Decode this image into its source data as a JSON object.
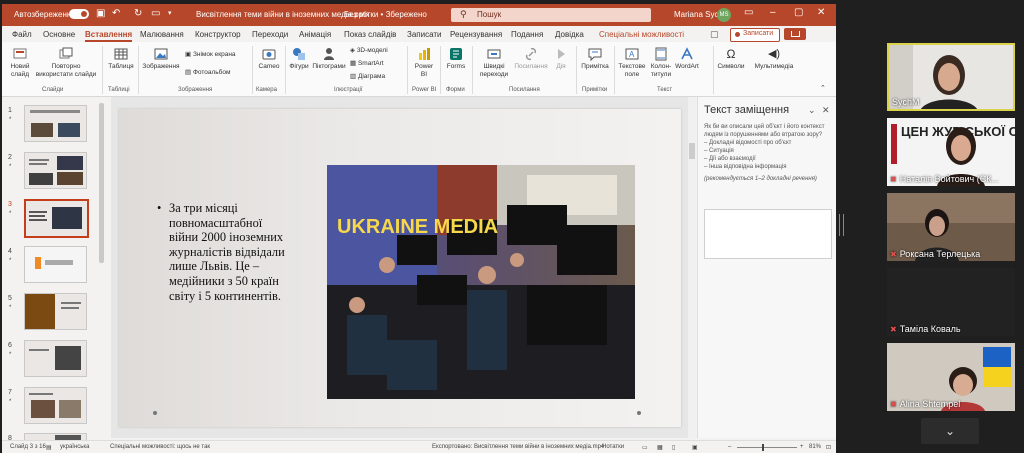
{
  "title_bar": {
    "autosave_label": "Автозбереження",
    "doc_title": "Висвітлення теми війни в іноземних медіа.pptx",
    "sensitivity": "Без мітки • Збережено",
    "search_placeholder": "Пошук",
    "user_name": "Mariana Sych",
    "user_initials": "MS"
  },
  "tabs": [
    "Файл",
    "Основне",
    "Вставлення",
    "Малювання",
    "Конструктор",
    "Переходи",
    "Анімація",
    "Показ слайдів",
    "Записати",
    "Рецензування",
    "Подання",
    "Довідка",
    "Спеціальні можливості"
  ],
  "active_tab": "Вставлення",
  "record_button": "Записати",
  "ribbon": {
    "new_slide": "Новий слайд",
    "reuse_slides": "Повторно використати слайди",
    "table": "Таблиця",
    "images": "Зображення",
    "screenshot": "Знімок екрана",
    "photo_album": "Фотоальбом",
    "cameo": "Cameo",
    "shapes": "Фігури",
    "pictograms": "Піктограми",
    "models3d": "3D-моделі",
    "smartart": "SmartArt",
    "diagram": "Діаграма",
    "powerbi": "Power BI",
    "forms": "Forms",
    "quick_links": "Швидкі переходи",
    "link": "Посилання",
    "action": "Дія",
    "comment": "Примітка",
    "textbox": "Текстове поле",
    "header_footer": "Колон-титули",
    "wordart": "WordArt",
    "symbols": "Символи",
    "multimedia": "Мультимедіа",
    "groups": {
      "slides": "Слайди",
      "tables": "Таблиці",
      "images": "Зображення",
      "camera": "Камера",
      "illustrations": "Ілюстрації",
      "powerbi": "Power BI",
      "forms": "Форми",
      "links": "Посилання",
      "comments": "Примітки",
      "text": "Текст"
    }
  },
  "thumbnails": [
    {
      "num": "1",
      "star": "*"
    },
    {
      "num": "2",
      "star": "*"
    },
    {
      "num": "3",
      "star": "*"
    },
    {
      "num": "4",
      "star": "*"
    },
    {
      "num": "5",
      "star": "*"
    },
    {
      "num": "6",
      "star": "*"
    },
    {
      "num": "7",
      "star": "*"
    },
    {
      "num": "8",
      "star": ""
    }
  ],
  "slide": {
    "bullet_text": "За три місяці повномасштабної війни 2000 іноземних журналістів відвідали лише Львів. Це – медійники з 50 країн світу і 5 континентів."
  },
  "alt_text": {
    "title": "Текст заміщення",
    "description": "Як би ви описали цей об'єкт і його контекст людям із порушеннями або втратою зору?",
    "items": [
      "– Докладні відомості про об'єкт",
      "– Ситуація",
      "– Дії або взаємодії",
      "– Інша відповідна інформація"
    ],
    "hint": "(рекомендується 1–2 докладні речення)"
  },
  "status_bar": {
    "slide_counter": "Слайд 3 з 16",
    "language": "українська",
    "accessibility": "Спеціальні можливості: щось не так",
    "export_status": "Експортовано: Висвітлення теми війни в іноземних медіа.mp4",
    "notes": "Нотатки",
    "zoom": "81%"
  },
  "participants": [
    {
      "name": "SychM",
      "active": true
    },
    {
      "name": "Наталія Войтович (ЄК...",
      "muted": true
    },
    {
      "name": "Роксана Терлецька",
      "muted": true
    },
    {
      "name": "Таміла Коваль",
      "muted": true
    },
    {
      "name": "Alina Shtempel",
      "muted": true
    }
  ],
  "partner_logo_text": "ЦЕН ЖУР СЬКОЇ СОЛ ТІ",
  "photo_banner_text": "UKRAINE MEDIA",
  "colors": {
    "accent": "#b7472a",
    "active_speaker": "#d9d24a"
  }
}
